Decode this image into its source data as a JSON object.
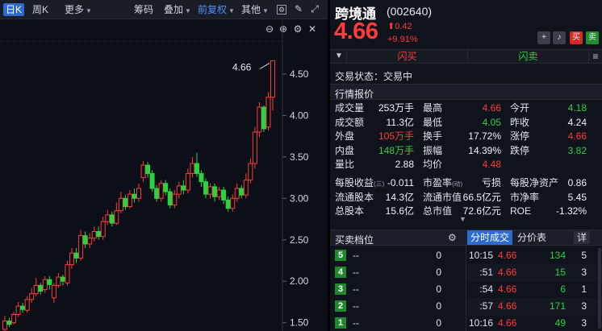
{
  "toolbar": {
    "period_day": "日K",
    "period_week": "周K",
    "more": "更多",
    "chips": "筹码",
    "overlay": "叠加",
    "adjust": "前复权",
    "other": "其他"
  },
  "chart_data": {
    "type": "candlestick",
    "price_label": "4.66",
    "yticks": [
      4.5,
      4.0,
      3.5,
      3.0,
      2.5,
      2.0,
      1.5
    ],
    "ytick_labels": [
      "4.50",
      "4.00",
      "3.50",
      "3.00",
      "2.50",
      "2.00",
      "1.50"
    ],
    "ylim": [
      1.4,
      4.8
    ],
    "candles": [
      {
        "o": 1.42,
        "c": 1.52,
        "h": 1.58,
        "l": 1.4
      },
      {
        "o": 1.52,
        "c": 1.48,
        "h": 1.56,
        "l": 1.45
      },
      {
        "o": 1.5,
        "c": 1.6,
        "h": 1.63,
        "l": 1.48
      },
      {
        "o": 1.6,
        "c": 1.7,
        "h": 1.75,
        "l": 1.57
      },
      {
        "o": 1.7,
        "c": 1.66,
        "h": 1.74,
        "l": 1.62
      },
      {
        "o": 1.65,
        "c": 1.78,
        "h": 1.82,
        "l": 1.62
      },
      {
        "o": 1.78,
        "c": 1.85,
        "h": 1.92,
        "l": 1.74
      },
      {
        "o": 1.85,
        "c": 1.95,
        "h": 2.04,
        "l": 1.82
      },
      {
        "o": 1.95,
        "c": 1.88,
        "h": 1.98,
        "l": 1.84
      },
      {
        "o": 1.9,
        "c": 2.02,
        "h": 2.06,
        "l": 1.86
      },
      {
        "o": 2.02,
        "c": 1.96,
        "h": 2.06,
        "l": 1.9
      },
      {
        "o": 1.8,
        "c": 1.95,
        "h": 1.98,
        "l": 1.74
      },
      {
        "o": 1.95,
        "c": 2.05,
        "h": 2.1,
        "l": 1.92
      },
      {
        "o": 2.05,
        "c": 2.0,
        "h": 2.08,
        "l": 1.95
      },
      {
        "o": 1.98,
        "c": 2.2,
        "h": 2.25,
        "l": 1.95
      },
      {
        "o": 2.2,
        "c": 2.34,
        "h": 2.4,
        "l": 2.15
      },
      {
        "o": 2.34,
        "c": 2.28,
        "h": 2.4,
        "l": 2.22
      },
      {
        "o": 2.28,
        "c": 2.55,
        "h": 2.62,
        "l": 2.25
      },
      {
        "o": 2.55,
        "c": 2.45,
        "h": 2.6,
        "l": 2.4
      },
      {
        "o": 2.45,
        "c": 2.52,
        "h": 2.58,
        "l": 2.4
      },
      {
        "o": 2.52,
        "c": 2.6,
        "h": 2.66,
        "l": 2.48
      },
      {
        "o": 2.6,
        "c": 2.54,
        "h": 2.66,
        "l": 2.5
      },
      {
        "o": 2.54,
        "c": 2.72,
        "h": 2.78,
        "l": 2.5
      },
      {
        "o": 2.72,
        "c": 2.8,
        "h": 2.86,
        "l": 2.68
      },
      {
        "o": 2.8,
        "c": 2.7,
        "h": 2.84,
        "l": 2.66
      },
      {
        "o": 2.7,
        "c": 2.85,
        "h": 2.95,
        "l": 2.68
      },
      {
        "o": 2.85,
        "c": 3.0,
        "h": 3.08,
        "l": 2.82
      },
      {
        "o": 3.0,
        "c": 2.9,
        "h": 3.04,
        "l": 2.86
      },
      {
        "o": 2.9,
        "c": 3.05,
        "h": 3.1,
        "l": 2.88
      },
      {
        "o": 3.05,
        "c": 3.0,
        "h": 3.12,
        "l": 2.95
      },
      {
        "o": 3.0,
        "c": 3.12,
        "h": 3.18,
        "l": 2.96
      },
      {
        "o": 3.25,
        "c": 3.4,
        "h": 3.45,
        "l": 3.2
      },
      {
        "o": 3.4,
        "c": 3.3,
        "h": 3.44,
        "l": 3.25
      },
      {
        "o": 3.3,
        "c": 3.12,
        "h": 3.34,
        "l": 3.08
      },
      {
        "o": 3.12,
        "c": 3.0,
        "h": 3.16,
        "l": 2.96
      },
      {
        "o": 3.0,
        "c": 3.18,
        "h": 3.22,
        "l": 2.96
      },
      {
        "o": 3.18,
        "c": 3.08,
        "h": 3.22,
        "l": 3.04
      },
      {
        "o": 3.08,
        "c": 2.92,
        "h": 3.12,
        "l": 2.88
      },
      {
        "o": 2.92,
        "c": 3.05,
        "h": 3.1,
        "l": 2.88
      },
      {
        "o": 3.05,
        "c": 3.15,
        "h": 3.2,
        "l": 3.0
      },
      {
        "o": 3.15,
        "c": 3.1,
        "h": 3.22,
        "l": 3.05
      },
      {
        "o": 3.1,
        "c": 3.3,
        "h": 3.36,
        "l": 3.06
      },
      {
        "o": 3.3,
        "c": 3.42,
        "h": 3.5,
        "l": 3.25
      },
      {
        "o": 3.42,
        "c": 3.3,
        "h": 3.55,
        "l": 3.26
      },
      {
        "o": 3.3,
        "c": 3.2,
        "h": 3.34,
        "l": 3.14
      },
      {
        "o": 3.2,
        "c": 3.05,
        "h": 3.24,
        "l": 3.0
      },
      {
        "o": 3.05,
        "c": 3.14,
        "h": 3.18,
        "l": 3.0
      },
      {
        "o": 3.14,
        "c": 3.02,
        "h": 3.18,
        "l": 2.96
      },
      {
        "o": 3.02,
        "c": 3.1,
        "h": 3.14,
        "l": 2.98
      },
      {
        "o": 3.1,
        "c": 2.98,
        "h": 3.14,
        "l": 2.93
      },
      {
        "o": 2.98,
        "c": 2.88,
        "h": 3.02,
        "l": 2.84
      },
      {
        "o": 2.88,
        "c": 3.0,
        "h": 3.05,
        "l": 2.84
      },
      {
        "o": 3.0,
        "c": 3.12,
        "h": 3.18,
        "l": 2.96
      },
      {
        "o": 3.12,
        "c": 3.04,
        "h": 3.16,
        "l": 3.0
      },
      {
        "o": 3.04,
        "c": 3.22,
        "h": 3.3,
        "l": 3.0
      },
      {
        "o": 3.22,
        "c": 3.42,
        "h": 3.48,
        "l": 3.18
      },
      {
        "o": 3.42,
        "c": 3.8,
        "h": 3.86,
        "l": 3.36
      },
      {
        "o": 3.8,
        "c": 4.1,
        "h": 4.16,
        "l": 3.74
      },
      {
        "o": 4.1,
        "c": 3.84,
        "h": 4.12,
        "l": 3.8
      },
      {
        "o": 3.86,
        "c": 4.22,
        "h": 4.28,
        "l": 3.82
      },
      {
        "o": 4.22,
        "c": 4.66,
        "h": 4.66,
        "l": 4.06
      }
    ]
  },
  "quote": {
    "name": "跨境通",
    "code": "(002640)",
    "price": "4.66",
    "change": "⬆0.42",
    "change_pct": "+9.91%",
    "buy_btn": "买",
    "sell_btn": "卖",
    "flash_buy": "闪买",
    "flash_sell": "闪卖",
    "status": "交易状态：交易中",
    "section": "行情报价"
  },
  "stats": [
    [
      {
        "l": "成交量",
        "v": "253万手",
        "c": "w"
      },
      {
        "l": "最高",
        "v": "4.66",
        "c": "r"
      },
      {
        "l": "今开",
        "v": "4.18",
        "c": "g"
      }
    ],
    [
      {
        "l": "成交额",
        "v": "11.3亿",
        "c": "w"
      },
      {
        "l": "最低",
        "v": "4.05",
        "c": "g"
      },
      {
        "l": "昨收",
        "v": "4.24",
        "c": "w"
      }
    ],
    [
      {
        "l": "外盘",
        "v": "105万手",
        "c": "r"
      },
      {
        "l": "换手",
        "v": "17.72%",
        "c": "w"
      },
      {
        "l": "涨停",
        "v": "4.66",
        "c": "r"
      }
    ],
    [
      {
        "l": "内盘",
        "v": "148万手",
        "c": "g"
      },
      {
        "l": "振幅",
        "v": "14.39%",
        "c": "w"
      },
      {
        "l": "跌停",
        "v": "3.82",
        "c": "g"
      }
    ],
    [
      {
        "l": "量比",
        "v": "2.88",
        "c": "w"
      },
      {
        "l": "均价",
        "v": "4.48",
        "c": "r"
      },
      {
        "l": "",
        "v": "",
        "c": "w"
      }
    ],
    [
      {
        "l": "每股收益",
        "sub": "(三)",
        "v": "-0.011",
        "c": "w"
      },
      {
        "l": "市盈率",
        "sub": "(动)",
        "v": "亏损",
        "c": "w"
      },
      {
        "l": "每股净资产",
        "v": "0.86",
        "c": "w"
      }
    ],
    [
      {
        "l": "流通股本",
        "v": "14.3亿",
        "c": "w"
      },
      {
        "l": "流通市值",
        "v": "66.5亿元",
        "c": "w"
      },
      {
        "l": "市净率",
        "v": "5.45",
        "c": "w"
      }
    ],
    [
      {
        "l": "总股本",
        "v": "15.6亿",
        "c": "w"
      },
      {
        "l": "总市值",
        "v": "72.6亿元",
        "c": "w"
      },
      {
        "l": "ROE",
        "v": "-1.32%",
        "c": "w"
      }
    ]
  ],
  "orderbook": {
    "title": "买卖档位",
    "levels": [
      {
        "level": "5",
        "price": "--",
        "qty": "0"
      },
      {
        "level": "4",
        "price": "--",
        "qty": "0"
      },
      {
        "level": "3",
        "price": "--",
        "qty": "0"
      },
      {
        "level": "2",
        "price": "--",
        "qty": "0"
      },
      {
        "level": "1",
        "price": "--",
        "qty": "0"
      }
    ]
  },
  "trades": {
    "tab_ticks": "分时成交",
    "tab_price": "分价表",
    "detail": "详",
    "rows": [
      {
        "time": "10:15",
        "price": "4.66",
        "vol": "134",
        "n": "5"
      },
      {
        "time": ":51",
        "price": "4.66",
        "vol": "15",
        "n": "3"
      },
      {
        "time": ":54",
        "price": "4.66",
        "vol": "6",
        "n": "1"
      },
      {
        "time": ":57",
        "price": "4.66",
        "vol": "171",
        "n": "3"
      },
      {
        "time": "10:16",
        "price": "4.66",
        "vol": "49",
        "n": "3"
      }
    ]
  },
  "colors": {
    "up": "#ff3b3b",
    "down": "#2bd341",
    "bg": "#0c0f17"
  }
}
